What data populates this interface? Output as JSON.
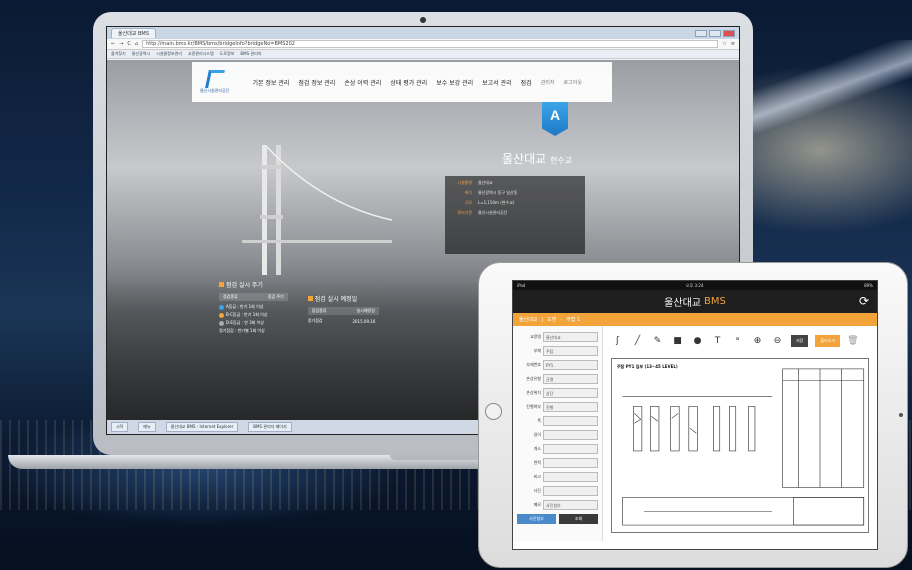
{
  "browser": {
    "tab_label": "울산대교 BMS",
    "url": "http://main.bms.kr/BMS/bms/bridgeInfo?bridgeNo=BMS202",
    "bookmarks": [
      "즐겨찾기",
      "울산광역시",
      "시설물정보관리",
      "교량관리시스템",
      "도로정보",
      "BMS 관리자"
    ]
  },
  "site": {
    "logo_text": "울산시설관리공단",
    "nav": [
      "기본 정보 관리",
      "점검 정보 관리",
      "손상 이력 관리",
      "상태 평가 관리",
      "보수 보강 관리",
      "보고서 관리",
      "점검"
    ],
    "user": "관리자",
    "logout": "로그아웃",
    "grade": "A",
    "bridge_name": "울산대교",
    "bridge_type": "현수교",
    "info": [
      {
        "k": "시설물명",
        "v": "울산대교"
      },
      {
        "k": "위치",
        "v": "울산광역시 동구 일산동"
      },
      {
        "k": "규모",
        "v": "L=1,150m (현수교)"
      },
      {
        "k": "관리기관",
        "v": "울산시설관리공단"
      }
    ],
    "schedule_title": "점검 실시 주기",
    "schedule_head": [
      "점검종류",
      "점검 주기"
    ],
    "schedule_lines": [
      "A등급 : 반기 1회 이상",
      "B·C등급 : 반기 1회 이상",
      "D·E등급 : 연 3회 이상"
    ],
    "schedule_note": "정기점검 : 반기별 1회 이상",
    "plan_title": "점검 실시 예정일",
    "plan_head": [
      "점검종류",
      "실시예정일"
    ],
    "plan_row": [
      "정기점검",
      "2015.09.16"
    ]
  },
  "taskbar": [
    "시작",
    "메뉴",
    "울산대교 BMS - Internet Explorer",
    "BMS 관리자 페이지"
  ],
  "tablet": {
    "status_left": "iPad",
    "status_time": "오후 3:24",
    "status_right": "89%",
    "title": "울산대교",
    "title_accent": "BMS",
    "breadcrumb": [
      "울산대교",
      "도면",
      "주탑 1"
    ],
    "form": [
      {
        "label": "교량명",
        "value": "울산대교"
      },
      {
        "label": "부재",
        "value": "주탑"
      },
      {
        "label": "부재번호",
        "value": "PY1"
      },
      {
        "label": "손상유형",
        "value": "균열"
      },
      {
        "label": "손상위치",
        "value": "상단"
      },
      {
        "label": "진행여부",
        "value": "진행"
      },
      {
        "label": "폭",
        "value": ""
      },
      {
        "label": "길이",
        "value": ""
      },
      {
        "label": "개소",
        "value": ""
      },
      {
        "label": "면적",
        "value": ""
      },
      {
        "label": "비고",
        "value": ""
      },
      {
        "label": "사진",
        "value": ""
      },
      {
        "label": "메모",
        "value": "사진첨부"
      }
    ],
    "form_buttons": [
      "사진첨부",
      "조회"
    ],
    "save_label": "저장",
    "load_label": "불러오기",
    "drawing_title": "주탑 PY1 입부 (13~45 LEVEL)"
  }
}
